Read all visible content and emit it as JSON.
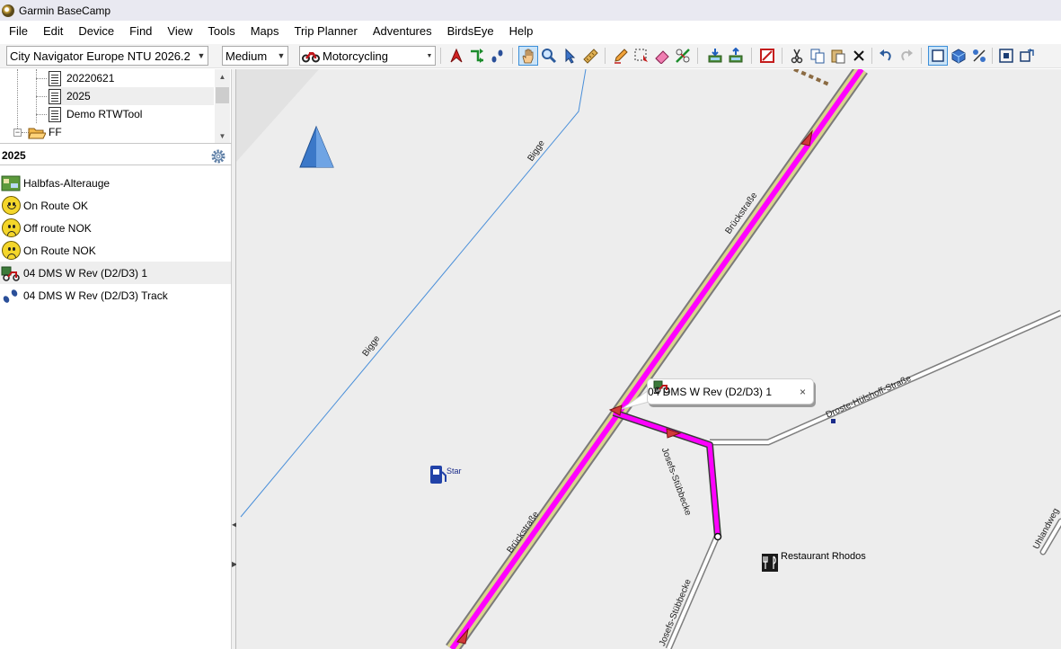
{
  "window": {
    "title": "Garmin BaseCamp"
  },
  "menu": [
    "File",
    "Edit",
    "Device",
    "Find",
    "View",
    "Tools",
    "Maps",
    "Trip Planner",
    "Adventures",
    "BirdsEye",
    "Help"
  ],
  "toolbar": {
    "map_product": "City Navigator Europe NTU 2026.2",
    "detail_level": "Medium",
    "activity_profile": "Motorcycling",
    "buttons": [
      "new-waypoint-icon",
      "new-route-icon",
      "new-track-icon",
      "hand-pan-icon",
      "zoom-icon",
      "select-arrow-icon",
      "measure-ruler-icon",
      "edit-pencil-icon",
      "select-area-icon",
      "eraser-icon",
      "divide-icon",
      "receive-from-device-icon",
      "send-to-device-icon",
      "no-entry-icon",
      "cut-icon",
      "copy-icon",
      "paste-icon",
      "delete-icon",
      "undo-icon",
      "redo-icon",
      "map-2d-icon",
      "map-3d-icon",
      "terrain-shading-icon",
      "fit-map-icon",
      "swap-window-icon"
    ]
  },
  "library": {
    "tree": [
      {
        "label": "20220621",
        "type": "list"
      },
      {
        "label": "2025",
        "type": "list",
        "selected": true
      },
      {
        "label": "Demo RTWTool",
        "type": "list"
      },
      {
        "label": "FF",
        "type": "folder"
      }
    ],
    "list_title": "2025",
    "items": [
      {
        "label": "Halbfas-Alterauge",
        "icon": "map-image-icon"
      },
      {
        "label": "On Route OK",
        "icon": "smiley-happy-icon"
      },
      {
        "label": "Off route NOK",
        "icon": "smiley-sad-icon"
      },
      {
        "label": "On Route NOK",
        "icon": "smiley-sad-icon"
      },
      {
        "label": "04 DMS W Rev (D2/D3) 1",
        "icon": "route-icon",
        "selected": true
      },
      {
        "label": "04 DMS W Rev (D2/D3) Track",
        "icon": "track-footprints-icon"
      }
    ]
  },
  "map": {
    "street_labels": [
      "Bigge",
      "Bigge",
      "Brückstraße",
      "Brückstraße",
      "Droste-Hülshoff-Straße",
      "Josefs-Stübbecke",
      "Josefs-Stübbecke",
      "Uhlandweg"
    ],
    "poi_labels": [
      "Star",
      "Restaurant Rhodos"
    ],
    "callout_label": "04 DMS W Rev (D2/D3) 1",
    "callout_close": "×",
    "colors": {
      "route": "#ff00ff",
      "main_road_casing": "#c9c38a",
      "water": "#4a8fd9",
      "background": "#ededed"
    }
  }
}
